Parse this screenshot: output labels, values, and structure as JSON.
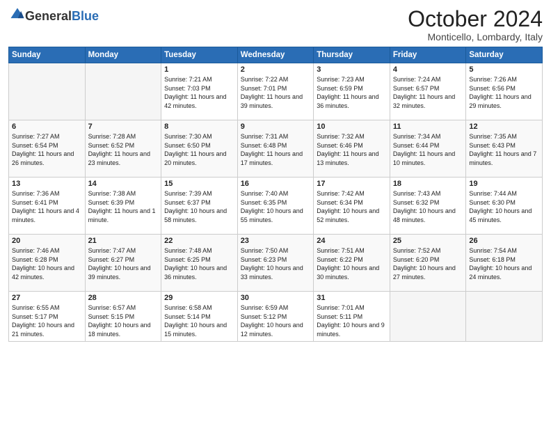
{
  "header": {
    "logo_general": "General",
    "logo_blue": "Blue",
    "month_title": "October 2024",
    "location": "Monticello, Lombardy, Italy"
  },
  "weekdays": [
    "Sunday",
    "Monday",
    "Tuesday",
    "Wednesday",
    "Thursday",
    "Friday",
    "Saturday"
  ],
  "weeks": [
    [
      {
        "day": "",
        "sunrise": "",
        "sunset": "",
        "daylight": "",
        "empty": true
      },
      {
        "day": "",
        "sunrise": "",
        "sunset": "",
        "daylight": "",
        "empty": true
      },
      {
        "day": "1",
        "sunrise": "Sunrise: 7:21 AM",
        "sunset": "Sunset: 7:03 PM",
        "daylight": "Daylight: 11 hours and 42 minutes."
      },
      {
        "day": "2",
        "sunrise": "Sunrise: 7:22 AM",
        "sunset": "Sunset: 7:01 PM",
        "daylight": "Daylight: 11 hours and 39 minutes."
      },
      {
        "day": "3",
        "sunrise": "Sunrise: 7:23 AM",
        "sunset": "Sunset: 6:59 PM",
        "daylight": "Daylight: 11 hours and 36 minutes."
      },
      {
        "day": "4",
        "sunrise": "Sunrise: 7:24 AM",
        "sunset": "Sunset: 6:57 PM",
        "daylight": "Daylight: 11 hours and 32 minutes."
      },
      {
        "day": "5",
        "sunrise": "Sunrise: 7:26 AM",
        "sunset": "Sunset: 6:56 PM",
        "daylight": "Daylight: 11 hours and 29 minutes."
      }
    ],
    [
      {
        "day": "6",
        "sunrise": "Sunrise: 7:27 AM",
        "sunset": "Sunset: 6:54 PM",
        "daylight": "Daylight: 11 hours and 26 minutes."
      },
      {
        "day": "7",
        "sunrise": "Sunrise: 7:28 AM",
        "sunset": "Sunset: 6:52 PM",
        "daylight": "Daylight: 11 hours and 23 minutes."
      },
      {
        "day": "8",
        "sunrise": "Sunrise: 7:30 AM",
        "sunset": "Sunset: 6:50 PM",
        "daylight": "Daylight: 11 hours and 20 minutes."
      },
      {
        "day": "9",
        "sunrise": "Sunrise: 7:31 AM",
        "sunset": "Sunset: 6:48 PM",
        "daylight": "Daylight: 11 hours and 17 minutes."
      },
      {
        "day": "10",
        "sunrise": "Sunrise: 7:32 AM",
        "sunset": "Sunset: 6:46 PM",
        "daylight": "Daylight: 11 hours and 13 minutes."
      },
      {
        "day": "11",
        "sunrise": "Sunrise: 7:34 AM",
        "sunset": "Sunset: 6:44 PM",
        "daylight": "Daylight: 11 hours and 10 minutes."
      },
      {
        "day": "12",
        "sunrise": "Sunrise: 7:35 AM",
        "sunset": "Sunset: 6:43 PM",
        "daylight": "Daylight: 11 hours and 7 minutes."
      }
    ],
    [
      {
        "day": "13",
        "sunrise": "Sunrise: 7:36 AM",
        "sunset": "Sunset: 6:41 PM",
        "daylight": "Daylight: 11 hours and 4 minutes."
      },
      {
        "day": "14",
        "sunrise": "Sunrise: 7:38 AM",
        "sunset": "Sunset: 6:39 PM",
        "daylight": "Daylight: 11 hours and 1 minute."
      },
      {
        "day": "15",
        "sunrise": "Sunrise: 7:39 AM",
        "sunset": "Sunset: 6:37 PM",
        "daylight": "Daylight: 10 hours and 58 minutes."
      },
      {
        "day": "16",
        "sunrise": "Sunrise: 7:40 AM",
        "sunset": "Sunset: 6:35 PM",
        "daylight": "Daylight: 10 hours and 55 minutes."
      },
      {
        "day": "17",
        "sunrise": "Sunrise: 7:42 AM",
        "sunset": "Sunset: 6:34 PM",
        "daylight": "Daylight: 10 hours and 52 minutes."
      },
      {
        "day": "18",
        "sunrise": "Sunrise: 7:43 AM",
        "sunset": "Sunset: 6:32 PM",
        "daylight": "Daylight: 10 hours and 48 minutes."
      },
      {
        "day": "19",
        "sunrise": "Sunrise: 7:44 AM",
        "sunset": "Sunset: 6:30 PM",
        "daylight": "Daylight: 10 hours and 45 minutes."
      }
    ],
    [
      {
        "day": "20",
        "sunrise": "Sunrise: 7:46 AM",
        "sunset": "Sunset: 6:28 PM",
        "daylight": "Daylight: 10 hours and 42 minutes."
      },
      {
        "day": "21",
        "sunrise": "Sunrise: 7:47 AM",
        "sunset": "Sunset: 6:27 PM",
        "daylight": "Daylight: 10 hours and 39 minutes."
      },
      {
        "day": "22",
        "sunrise": "Sunrise: 7:48 AM",
        "sunset": "Sunset: 6:25 PM",
        "daylight": "Daylight: 10 hours and 36 minutes."
      },
      {
        "day": "23",
        "sunrise": "Sunrise: 7:50 AM",
        "sunset": "Sunset: 6:23 PM",
        "daylight": "Daylight: 10 hours and 33 minutes."
      },
      {
        "day": "24",
        "sunrise": "Sunrise: 7:51 AM",
        "sunset": "Sunset: 6:22 PM",
        "daylight": "Daylight: 10 hours and 30 minutes."
      },
      {
        "day": "25",
        "sunrise": "Sunrise: 7:52 AM",
        "sunset": "Sunset: 6:20 PM",
        "daylight": "Daylight: 10 hours and 27 minutes."
      },
      {
        "day": "26",
        "sunrise": "Sunrise: 7:54 AM",
        "sunset": "Sunset: 6:18 PM",
        "daylight": "Daylight: 10 hours and 24 minutes."
      }
    ],
    [
      {
        "day": "27",
        "sunrise": "Sunrise: 6:55 AM",
        "sunset": "Sunset: 5:17 PM",
        "daylight": "Daylight: 10 hours and 21 minutes."
      },
      {
        "day": "28",
        "sunrise": "Sunrise: 6:57 AM",
        "sunset": "Sunset: 5:15 PM",
        "daylight": "Daylight: 10 hours and 18 minutes."
      },
      {
        "day": "29",
        "sunrise": "Sunrise: 6:58 AM",
        "sunset": "Sunset: 5:14 PM",
        "daylight": "Daylight: 10 hours and 15 minutes."
      },
      {
        "day": "30",
        "sunrise": "Sunrise: 6:59 AM",
        "sunset": "Sunset: 5:12 PM",
        "daylight": "Daylight: 10 hours and 12 minutes."
      },
      {
        "day": "31",
        "sunrise": "Sunrise: 7:01 AM",
        "sunset": "Sunset: 5:11 PM",
        "daylight": "Daylight: 10 hours and 9 minutes."
      },
      {
        "day": "",
        "sunrise": "",
        "sunset": "",
        "daylight": "",
        "empty": true
      },
      {
        "day": "",
        "sunrise": "",
        "sunset": "",
        "daylight": "",
        "empty": true
      }
    ]
  ]
}
